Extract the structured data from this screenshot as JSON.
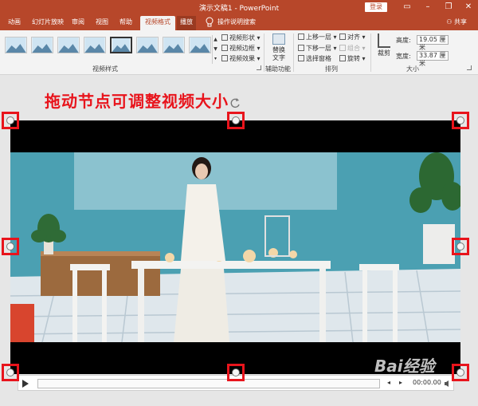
{
  "app": {
    "title": "演示文稿1 - PowerPoint",
    "login_label": "登录",
    "share_label": "共享"
  },
  "tabs": [
    {
      "label": "动画"
    },
    {
      "label": "幻灯片放映"
    },
    {
      "label": "审阅"
    },
    {
      "label": "视图"
    },
    {
      "label": "帮助"
    },
    {
      "label": "视频格式"
    },
    {
      "label": "播放"
    }
  ],
  "tell_me": "操作说明搜索",
  "ribbon": {
    "video_styles_group": "视频样式",
    "shape_label": "视频形状",
    "border_label": "视频边框",
    "effects_label": "视频效果",
    "accessibility_group": "辅助功能",
    "alt_text_line1": "替换",
    "alt_text_line2": "文字",
    "arrange_group": "排列",
    "bring_forward": "上移一层",
    "send_backward": "下移一层",
    "selection_pane": "选择窗格",
    "align": "对齐",
    "group": "组合",
    "rotate": "旋转",
    "crop": "裁剪",
    "size_group": "大小",
    "height_label": "高度:",
    "height_value": "19.05 厘米",
    "width_label": "宽度:",
    "width_value": "33.87 厘米"
  },
  "annotation": "拖动节点可调整视频大小",
  "playback": {
    "time": "00:00.00"
  },
  "watermark": "Bai经验",
  "colors": {
    "accent": "#b7472a",
    "annotation": "#e8141c"
  }
}
